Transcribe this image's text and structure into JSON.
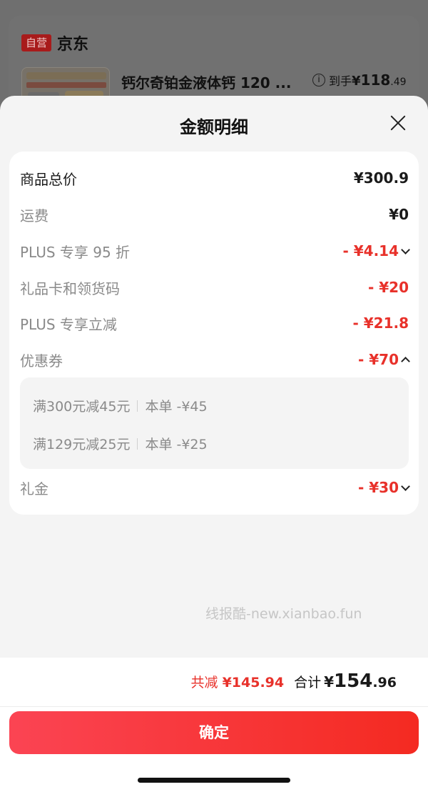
{
  "background": {
    "self_badge": "自营",
    "shop_name": "京东",
    "product_title": "钙尔奇铂金液体钙 120 ...",
    "info_icon": "info-icon",
    "final_price_label": "到手",
    "final_price_yen": "¥",
    "final_price_int": "118",
    "final_price_dec": ".49"
  },
  "sheet": {
    "title": "金额明细",
    "close_icon": "close-icon",
    "rows": [
      {
        "label": "商品总价",
        "value": "¥300.9"
      },
      {
        "label": "运费",
        "value": "¥0"
      },
      {
        "label": "PLUS 专享 95 折",
        "value": "- ¥4.14"
      },
      {
        "label": "礼品卡和领货码",
        "value": "- ¥20"
      },
      {
        "label": "PLUS 专享立减",
        "value": "- ¥21.8"
      },
      {
        "label": "优惠券",
        "value": "- ¥70"
      },
      {
        "label": "礼金",
        "value": "- ¥30"
      }
    ],
    "coupons": [
      {
        "name": "满300元减45元",
        "discount": "本单 -¥45"
      },
      {
        "name": "满129元减25元",
        "discount": "本单 -¥25"
      }
    ],
    "watermark": "线报酷-new.xianbao.fun"
  },
  "summary": {
    "saved_label": "共减",
    "saved_value": "¥145.94",
    "total_label": "合计",
    "total_yen": "¥",
    "total_int": "154",
    "total_dec": ".96",
    "confirm_label": "确定"
  },
  "colors": {
    "accent_red": "#e8312a",
    "button_gradient_start": "#fb4453",
    "button_gradient_end": "#f42a21"
  }
}
